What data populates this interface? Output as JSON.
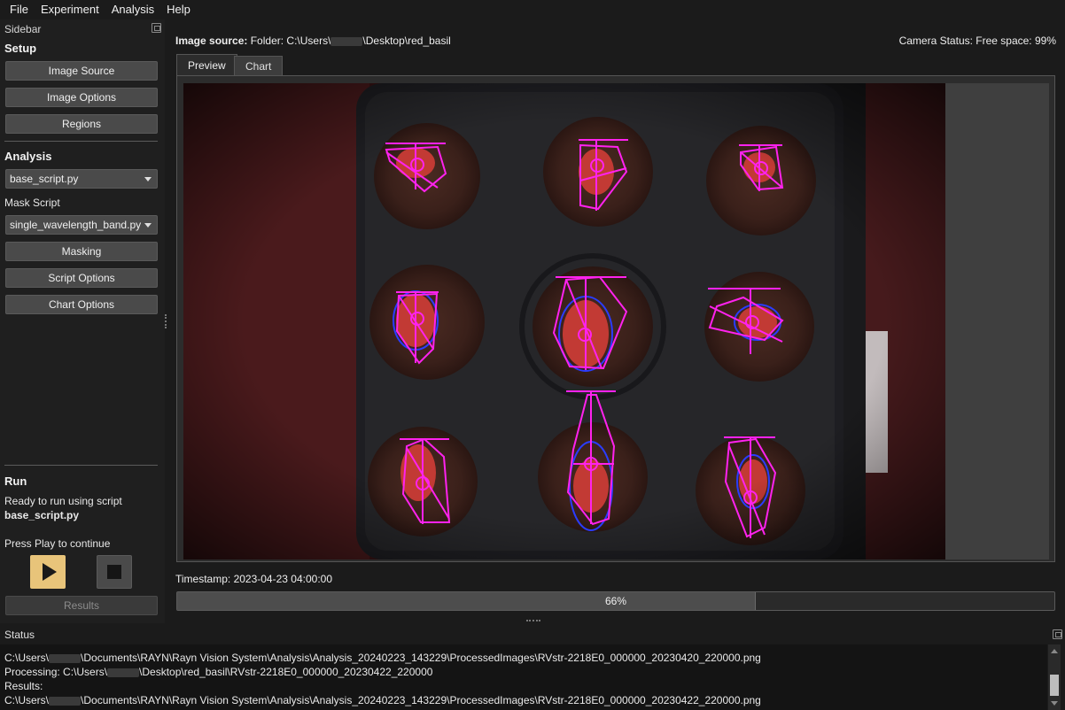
{
  "menu": {
    "items": [
      "File",
      "Experiment",
      "Analysis",
      "Help"
    ]
  },
  "sidebar": {
    "title": "Sidebar",
    "setup": {
      "heading": "Setup",
      "buttons": [
        "Image Source",
        "Image Options",
        "Regions"
      ]
    },
    "analysis": {
      "heading": "Analysis",
      "script_select": "base_script.py",
      "mask_label": "Mask Script",
      "mask_select": "single_wavelength_band.py",
      "buttons": [
        "Masking",
        "Script Options",
        "Chart Options"
      ]
    },
    "run": {
      "heading": "Run",
      "ready_text": "Ready to run using script",
      "script_name": "base_script.py",
      "prompt": "Press Play to continue",
      "play_icon": "play-icon",
      "stop_icon": "stop-icon",
      "results_label": "Results"
    }
  },
  "main": {
    "source_label": "Image source:",
    "source_prefix": "Folder: C:\\Users\\",
    "source_suffix": "\\Desktop\\red_basil",
    "camera_status": "Camera Status: Free space: 99%",
    "tabs": [
      "Preview",
      "Chart"
    ],
    "timestamp": "Timestamp: 2023-04-23 04:00:00",
    "progress": {
      "value": 0.66,
      "label": "66%"
    }
  },
  "status": {
    "title": "Status",
    "lines": [
      {
        "pre": "C:\\Users\\",
        "post": "\\Documents\\RAYN\\Rayn Vision System\\Analysis\\Analysis_20240223_143229\\ProcessedImages\\RVstr-2218E0_000000_20230420_220000.png"
      },
      {
        "pre": "Processing: C:\\Users\\",
        "post": "\\Desktop\\red_basil\\RVstr-2218E0_000000_20230422_220000"
      },
      {
        "pre": "Results:",
        "post": ""
      },
      {
        "pre": "C:\\Users\\",
        "post": "\\Documents\\RAYN\\Rayn Vision System\\Analysis\\Analysis_20240223_143229\\ProcessedImages\\RVstr-2218E0_000000_20230422_220000.png"
      }
    ]
  },
  "colors": {
    "accent_play": "#e8c47a",
    "overlay_magenta": "#ff22ee",
    "overlay_blue": "#2a3cff"
  }
}
